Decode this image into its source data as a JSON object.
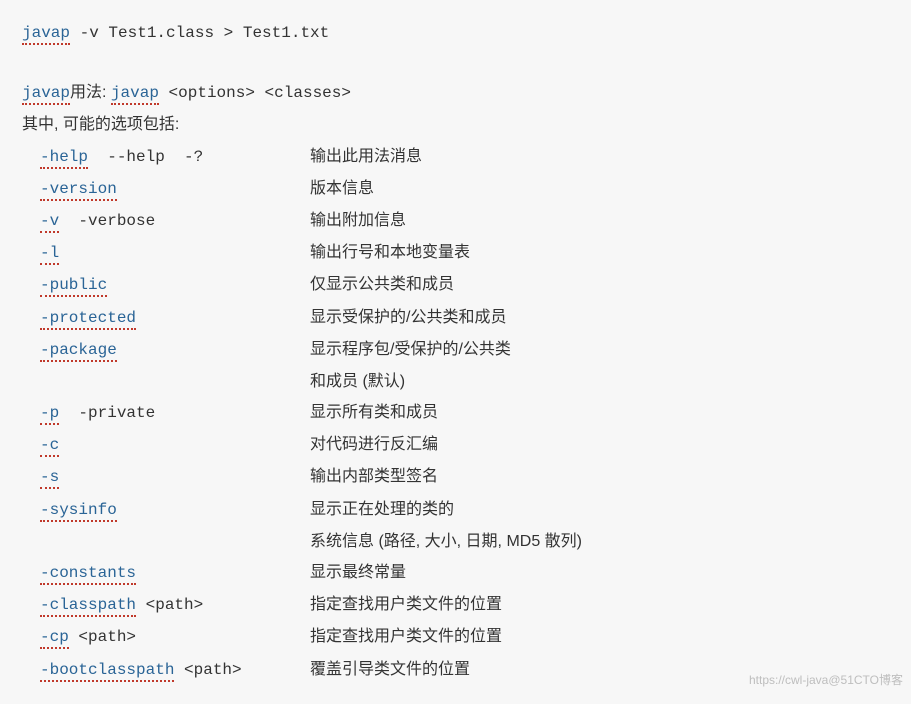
{
  "command": {
    "cmd": "javap",
    "args": " -v Test1.class > Test1.txt"
  },
  "usage": {
    "cmd": "javap",
    "label_zh": "用法: ",
    "syntax_cmd": "javap",
    "syntax_args": " <options> <classes>"
  },
  "desc_prefix": "其中, 可能的选项包括:",
  "options": [
    {
      "flag1": "-help",
      "flag_extra": "  --help  -?",
      "desc": "输出此用法消息"
    },
    {
      "flag1": "-version",
      "flag_extra": "",
      "desc": "版本信息"
    },
    {
      "flag1": "-v",
      "flag_extra": "  -verbose",
      "desc": "输出附加信息"
    },
    {
      "flag1": "-l",
      "flag_extra": "",
      "desc": "输出行号和本地变量表"
    },
    {
      "flag1": "-public",
      "flag_extra": "",
      "desc": "仅显示公共类和成员"
    },
    {
      "flag1": "-protected",
      "flag_extra": "",
      "desc": "显示受保护的/公共类和成员"
    },
    {
      "flag1": "-package",
      "flag_extra": "",
      "desc": "显示程序包/受保护的/公共类"
    },
    {
      "flag1": "",
      "flag_extra": "",
      "desc": "和成员 (默认)"
    },
    {
      "flag1": "-p",
      "flag_extra": "  -private",
      "desc": "显示所有类和成员"
    },
    {
      "flag1": "-c",
      "flag_extra": "",
      "desc": "对代码进行反汇编"
    },
    {
      "flag1": "-s",
      "flag_extra": "",
      "desc": "输出内部类型签名"
    },
    {
      "flag1": "-sysinfo",
      "flag_extra": "",
      "desc": "显示正在处理的类的"
    },
    {
      "flag1": "",
      "flag_extra": "",
      "desc": "系统信息 (路径, 大小, 日期, MD5 散列)"
    },
    {
      "flag1": "-constants",
      "flag_extra": "",
      "desc": "显示最终常量"
    },
    {
      "flag1": "-classpath",
      "flag_extra": " <path>",
      "desc": "指定查找用户类文件的位置"
    },
    {
      "flag1": "-cp",
      "flag_extra": " <path>",
      "desc": "指定查找用户类文件的位置"
    },
    {
      "flag1": "-bootclasspath",
      "flag_extra": " <path>",
      "desc": "覆盖引导类文件的位置"
    }
  ],
  "watermark": "https://cwl-java@51CTO博客"
}
